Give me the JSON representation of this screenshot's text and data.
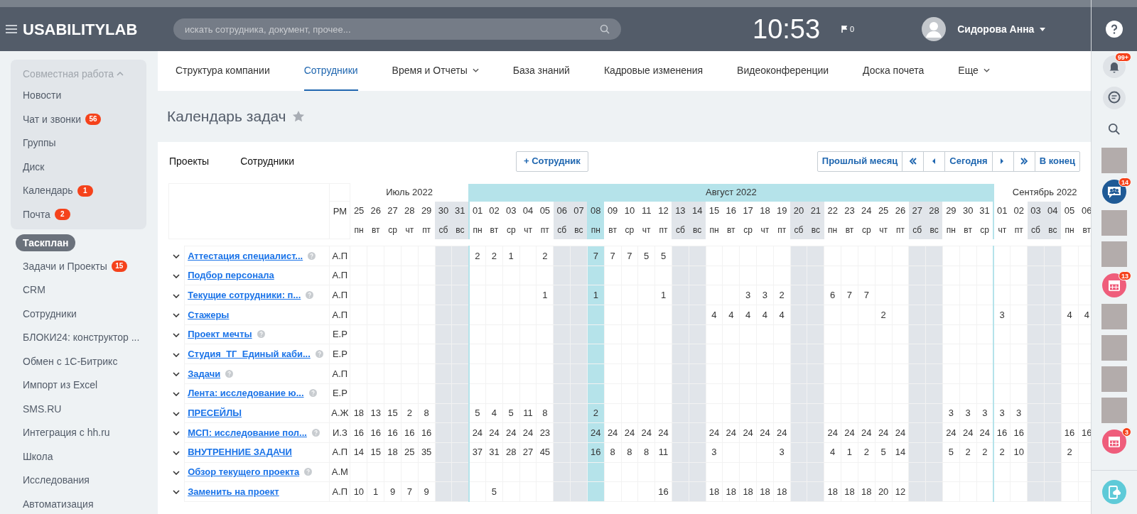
{
  "header": {
    "logo": "USABILITYLAB",
    "search": {
      "placeholder": "искать сотрудника, документ, прочее..."
    },
    "clock": "10:53",
    "flag_count": "0",
    "user": "Сидорова Анна"
  },
  "sidebar": {
    "group": {
      "label": "Совместная работа",
      "expanded": true,
      "items": [
        {
          "label": "Новости"
        },
        {
          "label": "Чат и звонки",
          "counter": "56"
        },
        {
          "label": "Группы"
        },
        {
          "label": "Диск"
        },
        {
          "label": "Календарь",
          "counter": "1"
        },
        {
          "label": "Почта",
          "counter": "2"
        }
      ]
    },
    "items": [
      {
        "label": "Таскплан",
        "selected": true
      },
      {
        "label": "Задачи и Проекты",
        "counter": "15",
        "selected": false
      },
      {
        "label": "CRM",
        "selected": false
      },
      {
        "label": "Сотрудники",
        "selected": false
      },
      {
        "label": "БЛОКИ24: конструктор ...",
        "selected": false
      },
      {
        "label": "Обмен с 1С-Битрикс",
        "selected": false
      },
      {
        "label": "Импорт из Excel",
        "selected": false
      },
      {
        "label": "SMS.RU",
        "selected": false
      },
      {
        "label": "Интеграция с hh.ru",
        "selected": false
      },
      {
        "label": "Школа",
        "selected": false
      },
      {
        "label": "Исследования",
        "selected": false
      },
      {
        "label": "Автоматизация",
        "selected": false
      }
    ]
  },
  "nav_tabs": [
    {
      "label": "Структура компании",
      "selected": false,
      "dropdown": false
    },
    {
      "label": "Сотрудники",
      "selected": true,
      "dropdown": false
    },
    {
      "label": "Время и Отчеты",
      "selected": false,
      "dropdown": true
    },
    {
      "label": "База знаний",
      "selected": false,
      "dropdown": false
    },
    {
      "label": "Кадровые изменения",
      "selected": false,
      "dropdown": false
    },
    {
      "label": "Видеоконференции",
      "selected": false,
      "dropdown": false
    },
    {
      "label": "Доска почета",
      "selected": false,
      "dropdown": false
    },
    {
      "label": "Еще",
      "selected": false,
      "dropdown": true
    }
  ],
  "page_title": "Календарь задач",
  "toolbar": {
    "tabs": [
      {
        "label": "Проекты"
      },
      {
        "label": "Сотрудники"
      }
    ],
    "add_button": "+ Сотрудник",
    "pager": [
      {
        "kind": "text",
        "label": "Прошлый месяц"
      },
      {
        "kind": "first"
      },
      {
        "kind": "prev"
      },
      {
        "kind": "text",
        "label": "Сегодня"
      },
      {
        "kind": "next"
      },
      {
        "kind": "last"
      },
      {
        "kind": "text",
        "label": "В конец"
      }
    ]
  },
  "calendar": {
    "pm_header": "РМ",
    "months": [
      {
        "label": "Июль 2022",
        "current": false,
        "days": [
          {
            "day": "25",
            "weekday": "пн",
            "weekend": false
          },
          {
            "day": "26",
            "weekday": "вт",
            "weekend": false
          },
          {
            "day": "27",
            "weekday": "ср",
            "weekend": false
          },
          {
            "day": "28",
            "weekday": "чт",
            "weekend": false
          },
          {
            "day": "29",
            "weekday": "пт",
            "weekend": false
          },
          {
            "day": "30",
            "weekday": "сб",
            "weekend": true
          },
          {
            "day": "31",
            "weekday": "вс",
            "weekend": true
          }
        ]
      },
      {
        "label": "Август 2022",
        "current": true,
        "days": [
          {
            "day": "01",
            "weekday": "пн",
            "weekend": false
          },
          {
            "day": "02",
            "weekday": "вт",
            "weekend": false
          },
          {
            "day": "03",
            "weekday": "ср",
            "weekend": false
          },
          {
            "day": "04",
            "weekday": "чт",
            "weekend": false
          },
          {
            "day": "05",
            "weekday": "пт",
            "weekend": false
          },
          {
            "day": "06",
            "weekday": "сб",
            "weekend": true
          },
          {
            "day": "07",
            "weekday": "вс",
            "weekend": true
          },
          {
            "day": "08",
            "weekday": "пн",
            "weekend": false,
            "today": true
          },
          {
            "day": "09",
            "weekday": "вт",
            "weekend": false
          },
          {
            "day": "10",
            "weekday": "ср",
            "weekend": false
          },
          {
            "day": "11",
            "weekday": "чт",
            "weekend": false
          },
          {
            "day": "12",
            "weekday": "пт",
            "weekend": false
          },
          {
            "day": "13",
            "weekday": "сб",
            "weekend": true
          },
          {
            "day": "14",
            "weekday": "вс",
            "weekend": true
          },
          {
            "day": "15",
            "weekday": "пн",
            "weekend": false
          },
          {
            "day": "16",
            "weekday": "вт",
            "weekend": false
          },
          {
            "day": "17",
            "weekday": "ср",
            "weekend": false
          },
          {
            "day": "18",
            "weekday": "чт",
            "weekend": false
          },
          {
            "day": "19",
            "weekday": "пт",
            "weekend": false
          },
          {
            "day": "20",
            "weekday": "сб",
            "weekend": true
          },
          {
            "day": "21",
            "weekday": "вс",
            "weekend": true
          },
          {
            "day": "22",
            "weekday": "пн",
            "weekend": false
          },
          {
            "day": "23",
            "weekday": "вт",
            "weekend": false
          },
          {
            "day": "24",
            "weekday": "ср",
            "weekend": false
          },
          {
            "day": "25",
            "weekday": "чт",
            "weekend": false
          },
          {
            "day": "26",
            "weekday": "пт",
            "weekend": false
          },
          {
            "day": "27",
            "weekday": "сб",
            "weekend": true
          },
          {
            "day": "28",
            "weekday": "вс",
            "weekend": true
          },
          {
            "day": "29",
            "weekday": "пн",
            "weekend": false
          },
          {
            "day": "30",
            "weekday": "вт",
            "weekend": false
          },
          {
            "day": "31",
            "weekday": "ср",
            "weekend": false
          }
        ]
      },
      {
        "label": "Сентябрь 2022",
        "current": false,
        "days": [
          {
            "day": "01",
            "weekday": "чт",
            "weekend": false
          },
          {
            "day": "02",
            "weekday": "пт",
            "weekend": false
          },
          {
            "day": "03",
            "weekday": "сб",
            "weekend": true
          },
          {
            "day": "04",
            "weekday": "вс",
            "weekend": true
          },
          {
            "day": "05",
            "weekday": "пн",
            "weekend": false
          },
          {
            "day": "06",
            "weekday": "вт",
            "weekend": false
          }
        ]
      }
    ],
    "rows": [
      {
        "name": "Аттестация специалист...",
        "info": true,
        "pm": "А.П",
        "hours": {
          "1-0": "2",
          "1-1": "2",
          "1-2": "1",
          "1-4": "2",
          "1-7": "7",
          "1-8": "7",
          "1-9": "7",
          "1-10": "5",
          "1-11": "5"
        }
      },
      {
        "name": "Подбор персонала",
        "info": false,
        "pm": "А.П"
      },
      {
        "name": "Текущие сотрудники: п...",
        "info": true,
        "pm": "А.П",
        "hours": {
          "1-4": "1",
          "1-7": "1",
          "1-11": "1",
          "1-16": "3",
          "1-17": "3",
          "1-18": "2",
          "1-21": "6",
          "1-22": "7",
          "1-23": "7"
        }
      },
      {
        "name": "Стажеры",
        "info": false,
        "pm": "А.П",
        "hours": {
          "1-14": "4",
          "1-15": "4",
          "1-16": "4",
          "1-17": "4",
          "1-18": "4",
          "1-24": "2",
          "2-0": "3",
          "2-4": "4",
          "2-5": "4"
        }
      },
      {
        "name": "Проект мечты",
        "info": true,
        "pm": "Е.Р"
      },
      {
        "name": "Студия_ТГ_Единый каби...",
        "info": true,
        "pm": "Е.Р"
      },
      {
        "name": "Задачи",
        "info": true,
        "pm": "А.П"
      },
      {
        "name": "Лента: исследование ю...",
        "info": true,
        "pm": "Е.Р"
      },
      {
        "name": "ПРЕСЕЙЛЫ",
        "info": false,
        "pm": "А.Ж",
        "hours": {
          "0-0": "18",
          "0-1": "13",
          "0-2": "15",
          "0-3": "2",
          "0-4": "8",
          "1-0": "5",
          "1-1": "4",
          "1-2": "5",
          "1-3": "11",
          "1-4": "8",
          "1-7": "2",
          "1-28": "3",
          "1-29": "3",
          "1-30": "3",
          "2-0": "3",
          "2-1": "3"
        }
      },
      {
        "name": "МСП: исследование пол...",
        "info": true,
        "pm": "И.З",
        "hours": {
          "0-0": "16",
          "0-1": "16",
          "0-2": "16",
          "0-3": "16",
          "0-4": "16",
          "1-0": "24",
          "1-1": "24",
          "1-2": "24",
          "1-3": "24",
          "1-4": "23",
          "1-7": "24",
          "1-8": "24",
          "1-9": "24",
          "1-10": "24",
          "1-11": "24",
          "1-14": "24",
          "1-15": "24",
          "1-16": "24",
          "1-17": "24",
          "1-18": "24",
          "1-21": "24",
          "1-22": "24",
          "1-23": "24",
          "1-24": "24",
          "1-25": "24",
          "1-28": "24",
          "1-29": "24",
          "1-30": "24",
          "2-0": "16",
          "2-1": "16",
          "2-4": "16",
          "2-5": "16"
        }
      },
      {
        "name": "ВНУТРЕННИЕ ЗАДАЧИ",
        "info": false,
        "pm": "А.П",
        "hours": {
          "0-0": "14",
          "0-1": "15",
          "0-2": "18",
          "0-3": "25",
          "0-4": "35",
          "1-0": "37",
          "1-1": "31",
          "1-2": "28",
          "1-3": "27",
          "1-4": "45",
          "1-7": "16",
          "1-8": "8",
          "1-9": "8",
          "1-10": "8",
          "1-11": "11",
          "1-14": "3",
          "1-18": "3",
          "1-21": "4",
          "1-22": "1",
          "1-23": "2",
          "1-24": "5",
          "1-25": "14",
          "1-28": "5",
          "1-29": "2",
          "1-30": "2",
          "2-0": "2",
          "2-1": "10",
          "2-4": "2"
        }
      },
      {
        "name": "Обзор текущего проекта",
        "info": true,
        "pm": "А.М"
      },
      {
        "name": "Заменить на проект",
        "info": false,
        "pm": "А.П",
        "hours": {
          "0-0": "10",
          "0-1": "1",
          "0-2": "9",
          "0-3": "7",
          "0-4": "9",
          "1-1": "5",
          "1-11": "16",
          "1-14": "18",
          "1-15": "18",
          "1-16": "18",
          "1-17": "18",
          "1-18": "18",
          "1-21": "18",
          "1-22": "18",
          "1-23": "18",
          "1-24": "20",
          "1-25": "12"
        }
      }
    ]
  },
  "right_rail": [
    {
      "kind": "bell",
      "badge": "99+"
    },
    {
      "kind": "chat"
    },
    {
      "kind": "search"
    },
    {
      "kind": "avatar"
    },
    {
      "kind": "group-chat",
      "badge": "14"
    },
    {
      "kind": "avatar"
    },
    {
      "kind": "avatar"
    },
    {
      "kind": "calendar",
      "badge": "13"
    },
    {
      "kind": "avatar"
    },
    {
      "kind": "avatar"
    },
    {
      "kind": "avatar"
    },
    {
      "kind": "avatar"
    },
    {
      "kind": "calendar",
      "badge": "3"
    },
    {
      "kind": "phone"
    }
  ]
}
